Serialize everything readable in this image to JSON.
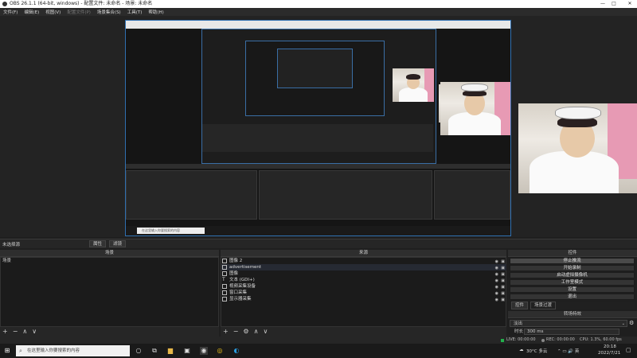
{
  "window": {
    "title": "OBS 26.1.1 (64-bit, windows) - 配置文件: 未命名 - 场景: 未命名",
    "minimize": "—",
    "maximize": "□",
    "close": "✕"
  },
  "menu": [
    "文件(F)",
    "编辑(E)",
    "视图(V)",
    "配置文件(P)",
    "场景集合(S)",
    "工具(T)",
    "帮助(H)"
  ],
  "nested_preview": {
    "search_placeholder": "在这里输入你要搜索的内容"
  },
  "scenes": {
    "header": "场景",
    "items": [
      "场景"
    ]
  },
  "sources": {
    "header": "来源",
    "items": [
      {
        "label": "图像 2",
        "icon": "image-icon"
      },
      {
        "label": "advertisement",
        "icon": "image-icon"
      },
      {
        "label": "图像",
        "icon": "image-icon"
      },
      {
        "label": "文本 (GDI+)",
        "icon": "text-icon"
      },
      {
        "label": "视频采集设备",
        "icon": "camera-icon"
      },
      {
        "label": "窗口采集",
        "icon": "window-icon"
      },
      {
        "label": "显示器采集",
        "icon": "monitor-icon"
      }
    ]
  },
  "controls": {
    "header": "控件",
    "buttons": [
      "停止推流",
      "开始录制",
      "启动虚拟摄像机",
      "工作室模式",
      "设置",
      "退出"
    ]
  },
  "dock_tabs": [
    "控件",
    "场景过渡"
  ],
  "transitions": {
    "header": "转场特效",
    "selected": "淡出",
    "duration_label": "时长",
    "duration_value": "300 ms"
  },
  "top_tabs": [
    "未选择源",
    "属性",
    "滤镜"
  ],
  "scene_toolbar": [
    "+",
    "−",
    "∧",
    "∨"
  ],
  "source_toolbar": [
    "+",
    "−",
    "⚙",
    "∧",
    "∨"
  ],
  "status": {
    "live": "LIVE: 00:00:00",
    "rec": "REC: 00:00:00",
    "cpu": "CPU: 1.3%, 60.00 fps"
  },
  "taskbar": {
    "search_placeholder": "在这里输入你要搜索的内容",
    "weather": "30°C 多云",
    "time": "20:18",
    "date": "2022/7/21"
  }
}
